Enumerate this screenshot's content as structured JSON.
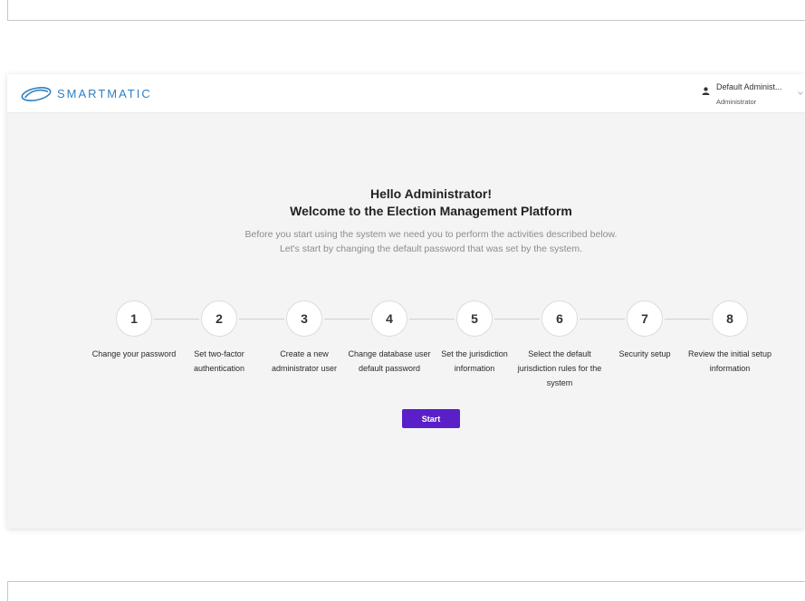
{
  "header": {
    "logo_text": "SMARTMATIC",
    "logo_icon": "smartmatic-swoosh-logo",
    "user_icon": "person-icon",
    "user_name": "Default Administ...",
    "user_role": "Administrator",
    "menu_icon": "chevron-down-icon"
  },
  "welcome": {
    "greeting": "Hello Administrator!",
    "title": "Welcome to the Election Management Platform",
    "description_lines": [
      "Before you start using the system we need you to perform the activities described below.",
      "Let's start by changing the default password that was set by the system."
    ]
  },
  "steps": [
    {
      "number": "1",
      "label_lines": [
        "Change your password"
      ]
    },
    {
      "number": "2",
      "label_lines": [
        "Set two-factor",
        "authentication"
      ]
    },
    {
      "number": "3",
      "label_lines": [
        "Create a new",
        "administrator user"
      ]
    },
    {
      "number": "4",
      "label_lines": [
        "Change database user",
        "default password"
      ]
    },
    {
      "number": "5",
      "label_lines": [
        "Set the jurisdiction",
        "information"
      ]
    },
    {
      "number": "6",
      "label_lines": [
        "Select the default",
        "jurisdiction rules for the",
        "system"
      ]
    },
    {
      "number": "7",
      "label_lines": [
        "Security setup"
      ]
    },
    {
      "number": "8",
      "label_lines": [
        "Review the initial setup",
        "information"
      ]
    }
  ],
  "actions": {
    "start_label": "Start"
  },
  "colors": {
    "brand_blue": "#2f7fc1",
    "accent_purple": "#5a1fc8",
    "body_background": "#f4f4f4"
  }
}
